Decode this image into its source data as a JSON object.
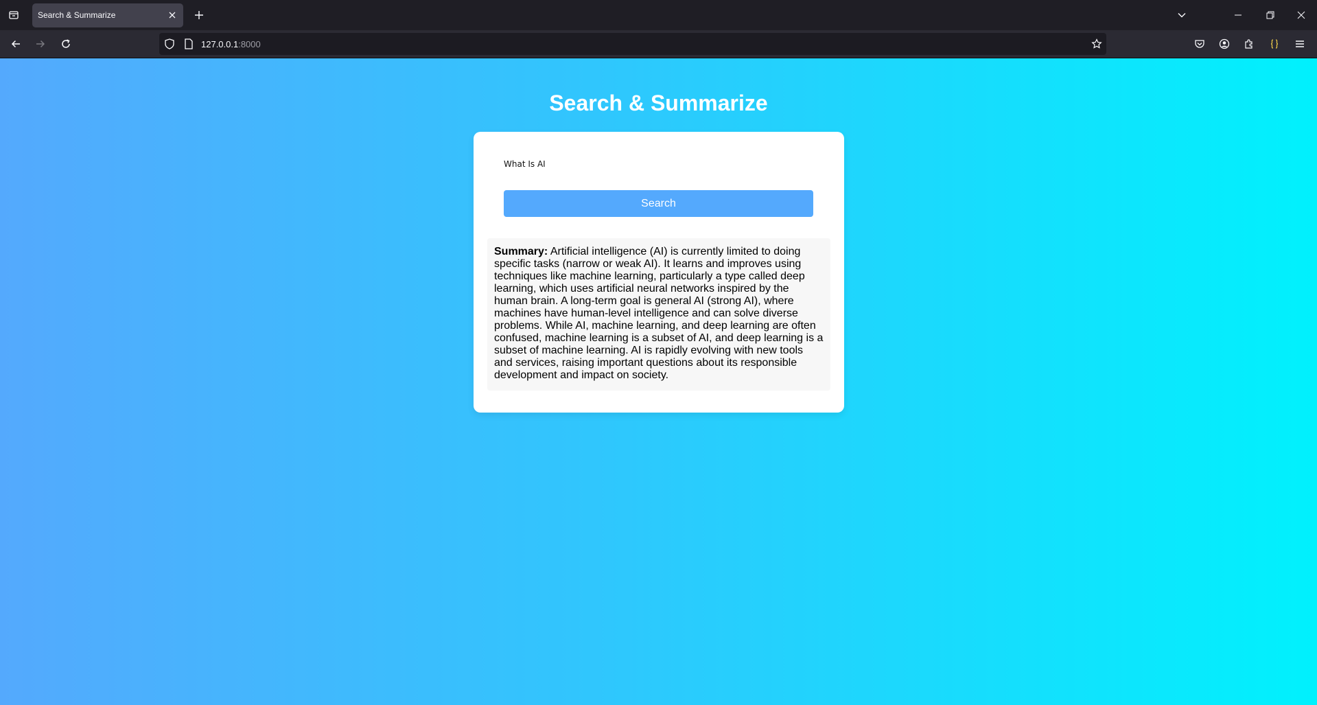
{
  "browser": {
    "tab_title": "Search & Summarize",
    "url_host": "127.0.0.1",
    "url_port": ":8000",
    "icons": {
      "tab_list": "tab-list-icon",
      "close_tab": "close-icon",
      "new_tab": "plus-icon",
      "list_all_tabs": "chevron-down-icon",
      "back": "arrow-left-icon",
      "forward": "arrow-right-icon",
      "reload": "reload-icon",
      "shield": "shield-icon",
      "page": "page-icon",
      "bookmark": "star-icon",
      "pocket": "pocket-icon",
      "account": "account-icon",
      "extensions": "puzzle-icon",
      "extension_json": "braces-icon",
      "menu": "hamburger-icon"
    }
  },
  "page": {
    "title": "Search & Summarize",
    "search": {
      "value": "What Is AI",
      "button_label": "Search"
    },
    "summary": {
      "label": "Summary:",
      "text": " Artificial intelligence (AI) is currently limited to doing specific tasks (narrow or weak AI). It learns and improves using techniques like machine learning, particularly a type called deep learning, which uses artificial neural networks inspired by the human brain. A long-term goal is general AI (strong AI), where machines have human-level intelligence and can solve diverse problems. While AI, machine learning, and deep learning are often confused, machine learning is a subset of AI, and deep learning is a subset of machine learning. AI is rapidly evolving with new tools and services, raising important questions about its responsible development and impact on society."
    }
  },
  "colors": {
    "gradient_start": "#54a9fd",
    "gradient_end": "#00f1fd",
    "button": "#54a9fd",
    "card": "#ffffff",
    "summary_bg": "#f7f7f7"
  }
}
